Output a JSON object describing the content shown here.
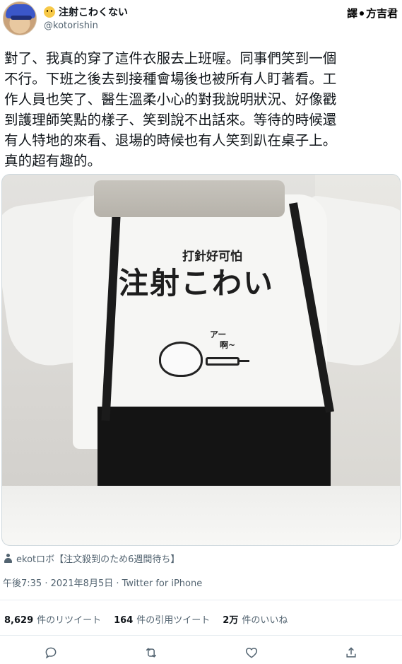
{
  "header": {
    "display_name": "注射こわくない",
    "handle": "@kotorishin",
    "credit_label": "譯",
    "credit_name": "方吉君"
  },
  "tweet": {
    "lines": [
      "對了、我真的穿了這件衣服去上班喔。同事們笑到一個",
      "不行。下班之後去到接種會場後也被所有人盯著看。工",
      "作人員也笑了、醫生溫柔小心的對我說明狀況、好像戳",
      "到護理師笑點的樣子、笑到說不出話來。等待的時候還",
      "有人特地的來看、退場的時候也有人笑到趴在桌子上。",
      "真的超有趣的。"
    ]
  },
  "media": {
    "shirt_small": "打針好可怕",
    "shirt_big": "注射こわい",
    "shirt_a": "アー",
    "shirt_b": "啊~"
  },
  "tagged_user": "ekotロボ【注文殺到のため6週間待ち】",
  "meta": {
    "time_date": "午後7:35 · 2021年8月5日",
    "source": "Twitter for iPhone"
  },
  "stats": {
    "retweets_count": "8,629",
    "retweets_label": "件のリツイート",
    "quotes_count": "164",
    "quotes_label": "件の引用ツイート",
    "likes_count": "2万",
    "likes_label": "件のいいね"
  },
  "icons": {
    "reply": "reply-icon",
    "retweet": "retweet-icon",
    "like": "heart-icon",
    "share": "share-icon"
  }
}
